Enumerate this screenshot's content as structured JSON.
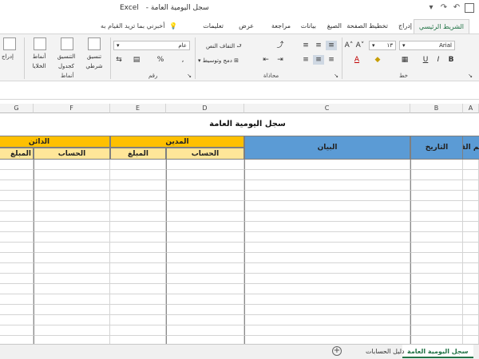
{
  "window": {
    "app_name": "Excel",
    "doc_title": "سجل اليومية العامة"
  },
  "ribbon": {
    "tabs": [
      "الشريط الرئيسي",
      "إدراج",
      "تخطيط الصفحة",
      "الصيغ",
      "بيانات",
      "مراجعة",
      "عرض",
      "تعليمات"
    ],
    "active_tab": "الشريط الرئيسي",
    "tell_me": "أخبرني بما تريد القيام به",
    "font_name": "Arial",
    "font_size": "١٣",
    "number_format": "عام",
    "wrap_text": "التفاف النص",
    "merge_center": "دمج وتوسيط",
    "conditional_formatting": "تنسيق شرطي",
    "format_as_table": "التنسيق كجدول",
    "cell_styles": "أنماط الخلايا",
    "insert": "إدراج",
    "group_font": "خط",
    "group_alignment": "محاذاة",
    "group_number": "رقم",
    "group_styles": "أنماط",
    "percent": "%",
    "comma": ","
  },
  "columns": [
    "A",
    "B",
    "C",
    "D",
    "E",
    "F",
    "G"
  ],
  "sheet": {
    "title": "سجل اليومية العامة",
    "col_entry": "رقم القيد",
    "col_date": "التاريخ",
    "col_description": "البيان",
    "debit": "المدين",
    "credit": "الدائن",
    "account": "الحساب",
    "amount": "المبلغ",
    "header_blue": "#5b9bd5",
    "header_orange": "#ffc000",
    "subheader_yellow": "#ffe699"
  },
  "sheet_tabs": [
    "سجل اليومية العامة",
    "دليل الحسابات"
  ],
  "active_sheet": "سجل اليومية العامة"
}
